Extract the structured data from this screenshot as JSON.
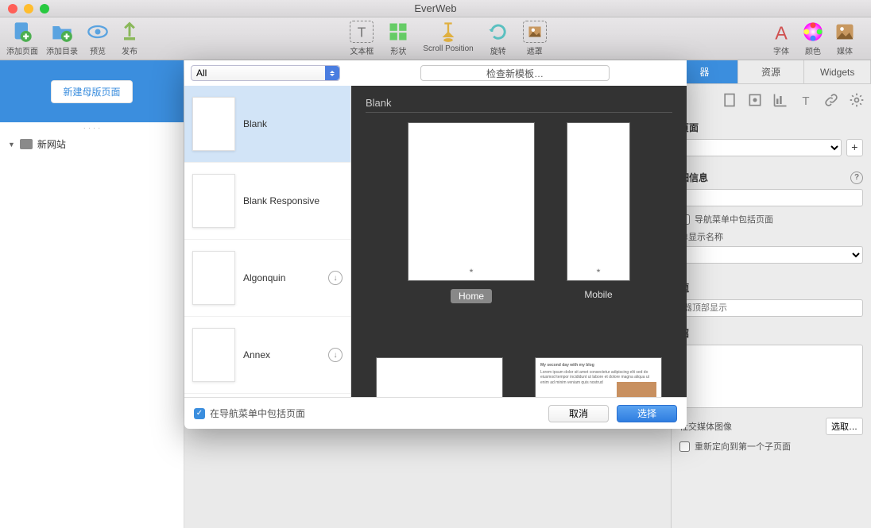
{
  "window": {
    "title": "EverWeb"
  },
  "toolbar": {
    "add_page": "添加页面",
    "add_dir": "添加目录",
    "preview": "预览",
    "publish": "发布",
    "textbox": "文本框",
    "shape": "形状",
    "scroll": "Scroll Position",
    "rotate": "旋转",
    "mask": "遮罩",
    "font": "字体",
    "color": "颜色",
    "media": "媒体"
  },
  "sidebar": {
    "new_master": "新建母版页面",
    "site": "新网站"
  },
  "rtabs": {
    "inspector": "器",
    "resources": "资源",
    "widgets": "Widgets"
  },
  "rpanel": {
    "page": "页面",
    "detail_info": "细信息",
    "nav_include": "导航菜单中包括页面",
    "nav_display": "单显示名称",
    "theme": "题",
    "browser_top": "器顶部显示",
    "intro": "绍",
    "social_img": "社交媒体图像",
    "select": "选取…",
    "redirect": "重新定向到第一个子页面"
  },
  "modal": {
    "filter": "All",
    "search": "检查新模板…",
    "templates": [
      {
        "name": "Blank",
        "dl": false
      },
      {
        "name": "Blank Responsive",
        "dl": false
      },
      {
        "name": "Algonquin",
        "dl": true
      },
      {
        "name": "Annex",
        "dl": true
      }
    ],
    "preview_title": "Blank",
    "thumbs": {
      "home": "Home",
      "mobile": "Mobile"
    },
    "blog_title": "My second day with my blog",
    "include_nav": "在导航菜单中包括页面",
    "cancel": "取消",
    "choose": "选择"
  }
}
